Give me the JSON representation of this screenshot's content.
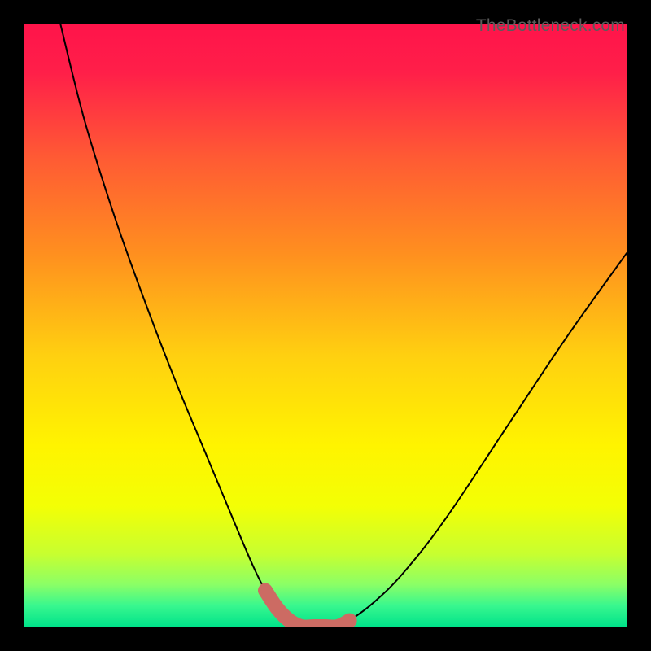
{
  "watermark": "TheBottleneck.com",
  "chart_data": {
    "type": "line",
    "title": "",
    "xlabel": "",
    "ylabel": "",
    "xlim": [
      0,
      100
    ],
    "ylim": [
      0,
      100
    ],
    "grid": false,
    "legend": false,
    "series": [
      {
        "name": "bottleneck-curve",
        "x": [
          6,
          10,
          15,
          20,
          25,
          30,
          35,
          38,
          40,
          42,
          44,
          46,
          48,
          50,
          52,
          54,
          58,
          63,
          70,
          80,
          90,
          100
        ],
        "y": [
          100,
          84,
          68,
          54,
          41,
          29,
          17,
          10,
          6,
          3,
          1,
          0,
          0,
          0,
          0,
          1,
          4,
          9,
          18,
          33,
          48,
          62
        ]
      }
    ],
    "highlight_region": {
      "name": "optimal-range",
      "x": [
        40,
        42,
        44,
        46,
        48,
        50,
        52,
        54
      ],
      "y": [
        6,
        3,
        1,
        0,
        0,
        0,
        0,
        1
      ]
    },
    "background_gradient_stops": [
      {
        "offset": 0.0,
        "color": "#ff144a"
      },
      {
        "offset": 0.08,
        "color": "#ff1f49"
      },
      {
        "offset": 0.22,
        "color": "#ff5a34"
      },
      {
        "offset": 0.38,
        "color": "#ff8f1f"
      },
      {
        "offset": 0.55,
        "color": "#ffd010"
      },
      {
        "offset": 0.7,
        "color": "#fff400"
      },
      {
        "offset": 0.8,
        "color": "#f3ff05"
      },
      {
        "offset": 0.88,
        "color": "#c7ff30"
      },
      {
        "offset": 0.93,
        "color": "#8bff66"
      },
      {
        "offset": 0.965,
        "color": "#39f78e"
      },
      {
        "offset": 1.0,
        "color": "#00e38a"
      }
    ]
  }
}
